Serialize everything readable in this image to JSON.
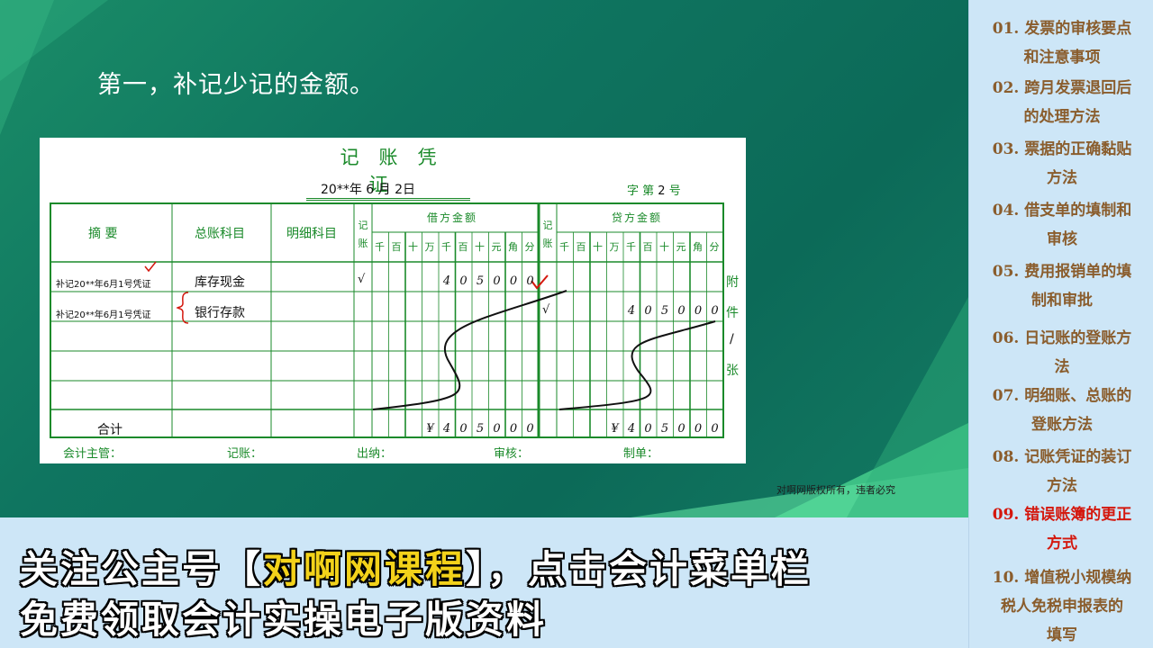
{
  "slide": {
    "title": "第一，补记少记的金额。",
    "copyright": "对啊网版权所有，违者必究"
  },
  "voucher": {
    "title": "记账凭证",
    "date": "20**年 6 月 2日",
    "number_prefix": "字  第",
    "number_value": "2",
    "number_suffix": "号",
    "headers": {
      "summary": "摘  要",
      "general_account": "总账科目",
      "detail_account": "明细科目",
      "posted_1": "记账",
      "debit": "借方金额",
      "posted_2": "记账",
      "credit": "贷方金额",
      "units": [
        "千",
        "百",
        "十",
        "万",
        "千",
        "百",
        "十",
        "元",
        "角",
        "分"
      ]
    },
    "rows": [
      {
        "summary": "补记20**年6月1号凭证",
        "account": "库存现金",
        "debit_mark": "√",
        "debit_digits": [
          "",
          "",
          "",
          "",
          "4",
          "0",
          "5",
          "0",
          "0",
          "0"
        ],
        "credit_mark": "",
        "credit_digits": [
          "",
          "",
          "",
          "",
          "",
          "",
          "",
          "",
          "",
          ""
        ]
      },
      {
        "summary": "补记20**年6月1号凭证",
        "account": "银行存款",
        "debit_mark": "",
        "debit_digits": [
          "",
          "",
          "",
          "",
          "",
          "",
          "",
          "",
          "",
          ""
        ],
        "credit_mark": "√",
        "credit_digits": [
          "",
          "",
          "",
          "",
          "4",
          "0",
          "5",
          "0",
          "0",
          "0"
        ]
      }
    ],
    "total_label": "合计",
    "total_debit_digits": [
      "",
      "",
      "",
      "¥",
      "4",
      "0",
      "5",
      "0",
      "0",
      "0"
    ],
    "total_credit_digits": [
      "",
      "",
      "",
      "¥",
      "4",
      "0",
      "5",
      "0",
      "0",
      "0"
    ],
    "attachment": [
      "附",
      "件",
      "/",
      "张"
    ],
    "signatures": [
      "会计主管：",
      "记账：",
      "出纳：",
      "审核：",
      "制单："
    ]
  },
  "footer": {
    "line1_pre": "关注公主号【",
    "line1_highlight": "对啊网课程",
    "line1_post": "】，点击会计菜单栏",
    "line2": "免费领取会计实操电子版资料"
  },
  "sidebar": {
    "items": [
      {
        "lines": [
          "01. 发票的审核要点",
          "和注意事项"
        ],
        "active": false
      },
      {
        "lines": [
          "02. 跨月发票退回后",
          "的处理方法"
        ],
        "active": false
      },
      {
        "lines": [
          "03. 票据的正确黏贴",
          "方法"
        ],
        "active": false
      },
      {
        "lines": [
          "04. 借支单的填制和",
          "审核"
        ],
        "active": false
      },
      {
        "lines": [
          "05. 费用报销单的填",
          "制和审批"
        ],
        "active": false
      },
      {
        "lines": [
          "06. 日记账的登账方",
          "法"
        ],
        "active": false
      },
      {
        "lines": [
          "07. 明细账、总账的",
          "登账方法"
        ],
        "active": false
      },
      {
        "lines": [
          "08. 记账凭证的装订",
          "方法"
        ],
        "active": false
      },
      {
        "lines": [
          "09. 错误账簿的更正",
          "方式"
        ],
        "active": true
      },
      {
        "lines": [
          "10. 增值税小规模纳",
          "税人免税申报表的",
          "填写"
        ],
        "active": false
      }
    ]
  },
  "colors": {
    "grid": "#1a8a2a",
    "accent_red": "#d4180e",
    "highlight": "#f3d21a",
    "sidebar_text": "#8a5d2d"
  }
}
